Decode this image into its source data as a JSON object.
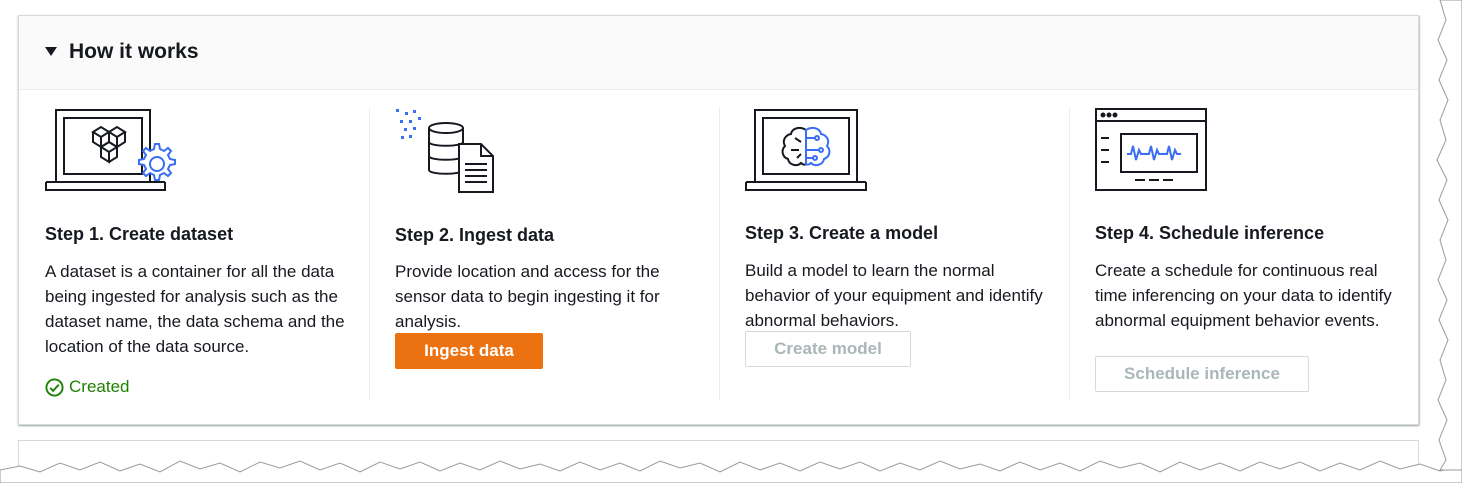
{
  "panel": {
    "title": "How it works"
  },
  "steps": [
    {
      "title": "Step 1. Create dataset",
      "description": "A dataset is a container for all the data being ingested for analysis such as the dataset name, the data schema and the location of the data source.",
      "status": "Created",
      "icon": "laptop-cubes-gear-icon"
    },
    {
      "title": "Step 2. Ingest data",
      "description": "Provide location and access for the sensor data to begin ingesting it for analysis.",
      "button": "Ingest data",
      "icon": "database-document-icon"
    },
    {
      "title": "Step 3. Create a model",
      "description": "Build a model to learn the normal behavior of your equipment and identify abnormal behaviors.",
      "button": "Create model",
      "icon": "laptop-brain-icon"
    },
    {
      "title": "Step 4. Schedule inference",
      "description": "Create a schedule for continuous real time inferencing on your data to identify abnormal equipment behavior events.",
      "button": "Schedule inference",
      "icon": "browser-waveform-icon"
    }
  ],
  "colors": {
    "primary_button": "#ec7211",
    "success": "#1d8102",
    "accent_blue": "#3b6ef5",
    "disabled_text": "#aab7b8"
  }
}
